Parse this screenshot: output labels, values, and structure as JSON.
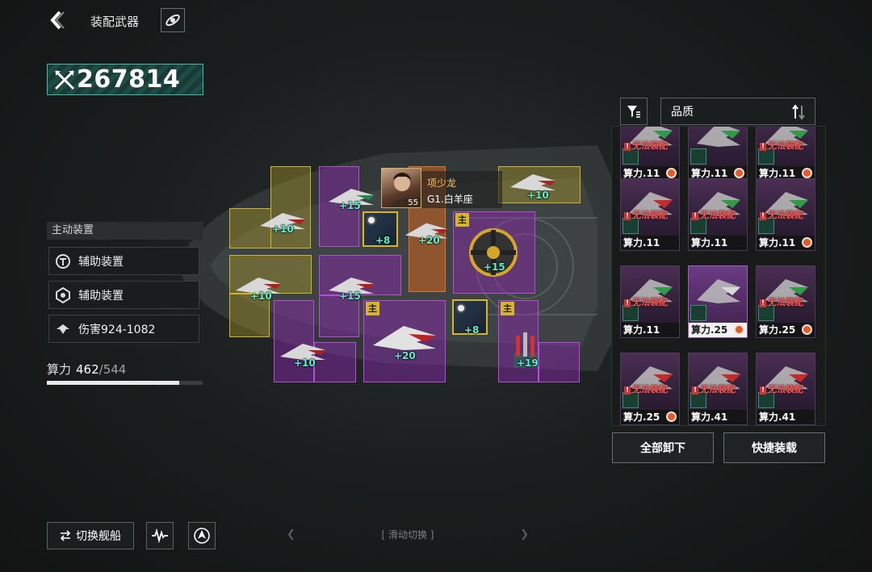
{
  "header": {
    "title": "装配武器"
  },
  "power_score": "267814",
  "left_panel": {
    "section_label": "主动装置",
    "items": [
      {
        "label": "辅助装置",
        "icon": "device-icon"
      },
      {
        "label": "辅助装置",
        "icon": "shield-device-icon"
      },
      {
        "label": "伤害924-1082",
        "icon": "damage-icon"
      }
    ],
    "compute": {
      "label": "算力",
      "current": "462",
      "max": "/544",
      "fill_fraction": 0.85
    }
  },
  "pilot": {
    "name": "项少龙",
    "sub": "G1.白羊座",
    "level": "55"
  },
  "slots": {
    "bonuses": [
      "+10",
      "+15",
      "+10",
      "+8",
      "+20",
      "+15",
      "+10",
      "+15",
      "+8",
      "+10",
      "+20",
      "+19"
    ],
    "main_tag": "主"
  },
  "inventory": {
    "sort_label": "品质",
    "warning": "无法装配",
    "cards": [
      {
        "power": "算力.11",
        "warn": true,
        "badge": true
      },
      {
        "power": "算力.11",
        "warn": false,
        "badge": true
      },
      {
        "power": "算力.11",
        "warn": true,
        "badge": true
      },
      {
        "power": "算力.11",
        "warn": true,
        "badge": false
      },
      {
        "power": "算力.11",
        "warn": true,
        "badge": false
      },
      {
        "power": "算力.11",
        "warn": true,
        "badge": true
      },
      {
        "power": "算力.11",
        "warn": true,
        "badge": false
      },
      {
        "power": "算力.25",
        "warn": false,
        "badge": true
      },
      {
        "power": "算力.25",
        "warn": true,
        "badge": true
      },
      {
        "power": "算力.25",
        "warn": true,
        "badge": true
      },
      {
        "power": "算力.41",
        "warn": true,
        "badge": false
      },
      {
        "power": "算力.41",
        "warn": true,
        "badge": false
      }
    ]
  },
  "actions": {
    "unequip_all": "全部卸下",
    "quick_equip": "快捷装载"
  },
  "bottom": {
    "switch_ship": "切换舰船",
    "swipe_label": "[ 滑动切换 ]"
  },
  "colors": {
    "accent": "#3fb9a8",
    "gold": "#cdb52c",
    "purple": "#b24fd6",
    "orange": "#dc7430",
    "warn": "#ff5454"
  }
}
